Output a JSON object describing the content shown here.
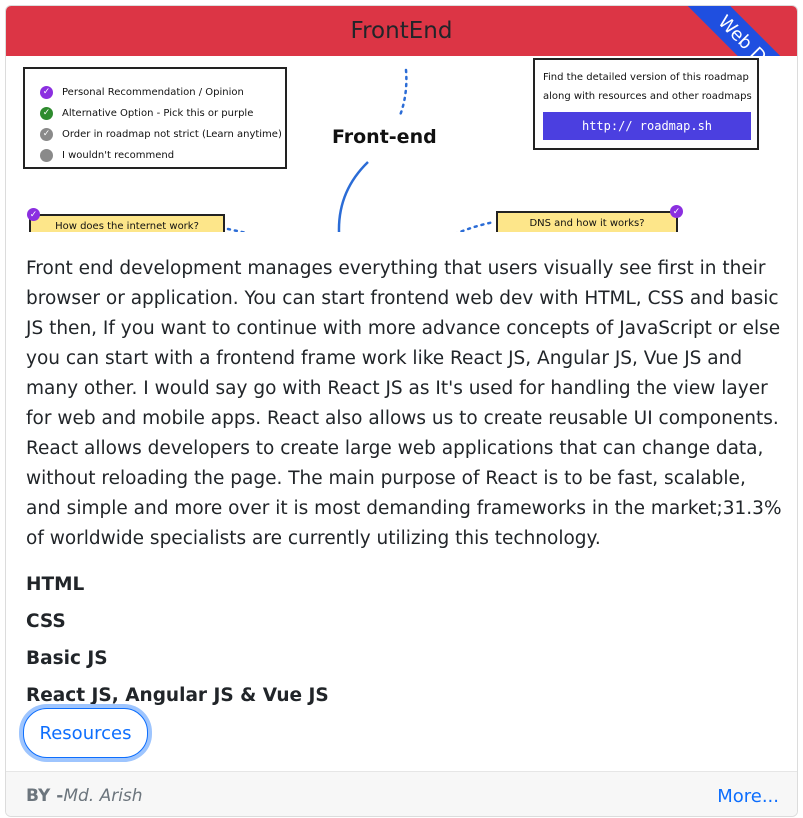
{
  "card": {
    "header_title": "FrontEnd",
    "ribbon_label": "Web Dev",
    "description": "Front end development manages everything that users visually see first in their browser or application. You can start frontend web dev with HTML, CSS and basic JS then, If you want to continue with more advance concepts of JavaScript or else you can start with a frontend frame work like React JS, Angular JS, Vue JS and many other. I would say go with React JS as It's used for handling the view layer for web and mobile apps. React also allows us to create reusable UI components. React allows developers to create large web applications that can change data, without reloading the page. The main purpose of React is to be fast, scalable, and simple and more over it is most demanding frameworks in the market;31.3% of worldwide specialists are currently utilizing this technology.",
    "topics": [
      "HTML",
      "CSS",
      "Basic JS",
      "React JS, Angular JS & Vue JS"
    ],
    "resources_label": "Resources",
    "author_prefix": "BY -",
    "author_name": "Md. Arish",
    "more_label": "More..."
  },
  "roadmap": {
    "legend": [
      {
        "label": "Personal Recommendation / Opinion",
        "color": "#8b2fe0"
      },
      {
        "label": "Alternative Option - Pick this or purple",
        "color": "#2e8b2e"
      },
      {
        "label": "Order in roadmap not strict (Learn anytime)",
        "color": "#8a8a8a"
      },
      {
        "label": "I wouldn't recommend",
        "color": "#8a8a8a"
      }
    ],
    "title": "Front-end",
    "info_line1": "Find the detailed version of this roadmap",
    "info_line2": "along with resources and other roadmaps",
    "info_link": "http:// roadmap.sh",
    "node_left": "How does the internet work?",
    "node_right": "DNS and how it works?"
  },
  "colors": {
    "header_bg": "#dc3545",
    "ribbon_bg": "#1f4fe0",
    "link": "#0d6efd",
    "node_bg": "#fde68a"
  }
}
